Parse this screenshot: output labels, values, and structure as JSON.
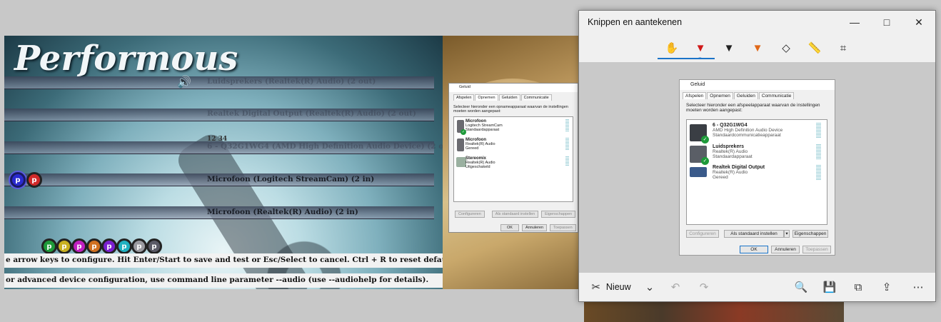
{
  "performous": {
    "logo": "Performous",
    "devices": [
      {
        "label": "Luidsprekers (Realtek(R) Audio) (2 out)"
      },
      {
        "label": "Realtek Digital Output (Realtek(R) Audio) (2 out)"
      },
      {
        "label": "6 - Q32G1WG4 (AMD High Definition Audio Device) (2 out)",
        "channels": "12 34"
      },
      {
        "label": "Microfoon (Logitech StreamCam) (2 in)"
      },
      {
        "label": "Microfoon (Realtek(R) Audio) (2 in)"
      }
    ],
    "mic_tags": [
      "p",
      "p",
      "p",
      "p",
      "p",
      "p",
      "p",
      "p",
      "p",
      "p"
    ],
    "hint_line_1": "e arrow keys to configure. Hit Enter/Start to save and test or Esc/Select to cancel. Ctrl + R to reset defaults",
    "hint_line_2": "or advanced device configuration, use command line parameter --audio (use --audiohelp for details)."
  },
  "geluid_small": {
    "title": "Geluid",
    "tabs": [
      "Afspelen",
      "Opnemen",
      "Geluiden",
      "Communicatie"
    ],
    "instruction": "Selecteer hieronder een opnameapparaat waarvan de instellingen moeten worden aangepast:",
    "devices": [
      {
        "name": "Microfoon",
        "sub1": "Logitech StreamCam",
        "sub2": "Standaardapparaat"
      },
      {
        "name": "Microfoon",
        "sub1": "Realtek(R) Audio",
        "sub2": "Gereed"
      },
      {
        "name": "Stereomix",
        "sub1": "Realtek(R) Audio",
        "sub2": "Uitgeschakeld"
      }
    ],
    "buttons": {
      "configure": "Configureren",
      "default": "Als standaard instellen",
      "properties": "Eigenschappen",
      "ok": "OK",
      "cancel": "Annuleren",
      "apply": "Toepassen"
    }
  },
  "snip": {
    "title": "Knippen en aantekenen",
    "new_label": "Nieuw",
    "icons": {
      "minimize": "minimize-icon",
      "maximize": "maximize-icon",
      "close": "close-icon"
    }
  },
  "geluid_big": {
    "title": "Geluid",
    "tabs": [
      "Afspelen",
      "Opnemen",
      "Geluiden",
      "Communicatie"
    ],
    "instruction": "Selecteer hieronder een afspeelapparaat waarvan de instellingen moeten worden aangepast:",
    "devices": [
      {
        "name": "6 - Q32G1WG4",
        "sub1": "AMD High Definition Audio Device",
        "sub2": "Standaardcommunicatieapparaat"
      },
      {
        "name": "Luidsprekers",
        "sub1": "Realtek(R) Audio",
        "sub2": "Standaardapparaat"
      },
      {
        "name": "Realtek Digital Output",
        "sub1": "Realtek(R) Audio",
        "sub2": "Gereed"
      }
    ],
    "buttons": {
      "configure": "Configureren",
      "default": "Als standaard instellen",
      "properties": "Eigenschappen",
      "ok": "OK",
      "cancel": "Annuleren",
      "apply": "Toepassen"
    }
  }
}
